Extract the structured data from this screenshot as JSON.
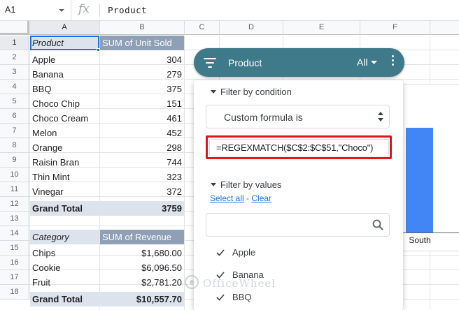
{
  "formula_bar": {
    "cell_ref": "A1",
    "fx": "fx",
    "value": "Product"
  },
  "columns": [
    "A",
    "B",
    "C",
    "D",
    "E",
    "F"
  ],
  "rows": [
    "1",
    "2",
    "3",
    "4",
    "5",
    "6",
    "7",
    "8",
    "9",
    "10",
    "11",
    "12",
    "13",
    "14",
    "15",
    "16",
    "17",
    "18"
  ],
  "pivot1": {
    "header": [
      "Product",
      "SUM of Unit Sold"
    ],
    "rows": [
      [
        "Apple",
        "304"
      ],
      [
        "Banana",
        "279"
      ],
      [
        "BBQ",
        "375"
      ],
      [
        "Choco Chip",
        "151"
      ],
      [
        "Choco Cream",
        "461"
      ],
      [
        "Melon",
        "452"
      ],
      [
        "Orange",
        "298"
      ],
      [
        "Raisin Bran",
        "744"
      ],
      [
        "Thin Mint",
        "323"
      ],
      [
        "Vinegar",
        "372"
      ]
    ],
    "total": [
      "Grand Total",
      "3759"
    ]
  },
  "pivot2": {
    "header": [
      "Category",
      "SUM of Revenue"
    ],
    "rows": [
      [
        "Chips",
        "$1,680.00"
      ],
      [
        "Cookie",
        "$6,096.50"
      ],
      [
        "Fruit",
        "$2,781.20"
      ]
    ],
    "total": [
      "Grand Total",
      "$10,557.70"
    ]
  },
  "chart": {
    "x_label": "South",
    "bar_color": "#4285f4"
  },
  "slicer": {
    "title": "Product",
    "filter_state": "All",
    "color": "#3f7a8b",
    "icons": [
      "filter-lines-icon",
      "dropdown-caret-icon",
      "more-vert-icon"
    ]
  },
  "filter_panel": {
    "by_condition_label": "Filter by condition",
    "condition": "Custom formula is",
    "formula": "=REGEXMATCH($C$2:$C$51,\"Choco\")",
    "highlight_color": "#e2151a",
    "by_values_label": "Filter by values",
    "select_all": "Select all",
    "separator": " - ",
    "clear": "Clear",
    "values": [
      "Apple",
      "Banana",
      "BBQ"
    ]
  },
  "watermark": {
    "text": "OfficeWheel"
  }
}
